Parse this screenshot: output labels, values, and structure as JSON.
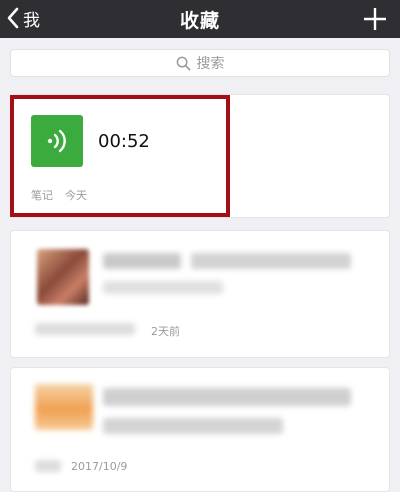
{
  "navbar": {
    "back_label": "我",
    "title": "收藏",
    "add_icon": "plus-icon"
  },
  "search": {
    "placeholder": "搜索",
    "icon": "search-icon"
  },
  "items": [
    {
      "type_label": "笔记",
      "time": "今天",
      "duration": "00:52",
      "icon": "voice-icon",
      "icon_color": "#3bab3e"
    },
    {
      "time": "2天前"
    },
    {
      "time": "2017/10/9"
    }
  ],
  "colors": {
    "navbar": "#2f2f33",
    "highlight": "#a40f16",
    "background": "#efeff4"
  }
}
